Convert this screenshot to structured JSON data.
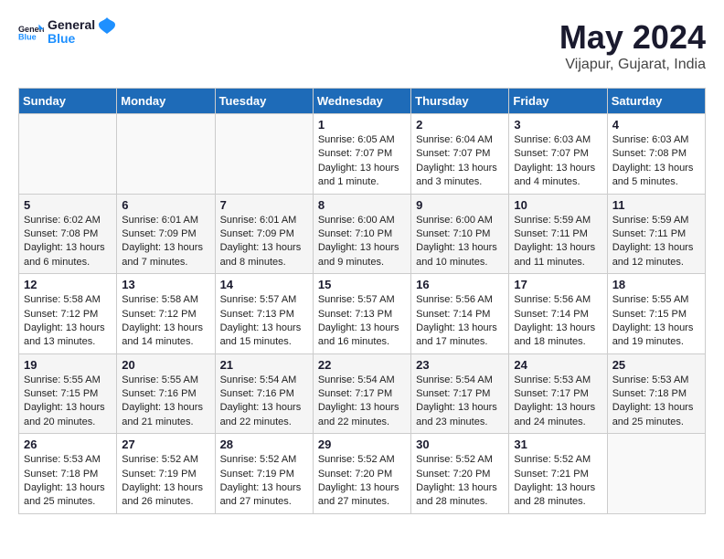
{
  "header": {
    "logo_general": "General",
    "logo_blue": "Blue",
    "month_year": "May 2024",
    "location": "Vijapur, Gujarat, India"
  },
  "days_of_week": [
    "Sunday",
    "Monday",
    "Tuesday",
    "Wednesday",
    "Thursday",
    "Friday",
    "Saturday"
  ],
  "weeks": [
    [
      {
        "day": "",
        "info": ""
      },
      {
        "day": "",
        "info": ""
      },
      {
        "day": "",
        "info": ""
      },
      {
        "day": "1",
        "info": "Sunrise: 6:05 AM\nSunset: 7:07 PM\nDaylight: 13 hours\nand 1 minute."
      },
      {
        "day": "2",
        "info": "Sunrise: 6:04 AM\nSunset: 7:07 PM\nDaylight: 13 hours\nand 3 minutes."
      },
      {
        "day": "3",
        "info": "Sunrise: 6:03 AM\nSunset: 7:07 PM\nDaylight: 13 hours\nand 4 minutes."
      },
      {
        "day": "4",
        "info": "Sunrise: 6:03 AM\nSunset: 7:08 PM\nDaylight: 13 hours\nand 5 minutes."
      }
    ],
    [
      {
        "day": "5",
        "info": "Sunrise: 6:02 AM\nSunset: 7:08 PM\nDaylight: 13 hours\nand 6 minutes."
      },
      {
        "day": "6",
        "info": "Sunrise: 6:01 AM\nSunset: 7:09 PM\nDaylight: 13 hours\nand 7 minutes."
      },
      {
        "day": "7",
        "info": "Sunrise: 6:01 AM\nSunset: 7:09 PM\nDaylight: 13 hours\nand 8 minutes."
      },
      {
        "day": "8",
        "info": "Sunrise: 6:00 AM\nSunset: 7:10 PM\nDaylight: 13 hours\nand 9 minutes."
      },
      {
        "day": "9",
        "info": "Sunrise: 6:00 AM\nSunset: 7:10 PM\nDaylight: 13 hours\nand 10 minutes."
      },
      {
        "day": "10",
        "info": "Sunrise: 5:59 AM\nSunset: 7:11 PM\nDaylight: 13 hours\nand 11 minutes."
      },
      {
        "day": "11",
        "info": "Sunrise: 5:59 AM\nSunset: 7:11 PM\nDaylight: 13 hours\nand 12 minutes."
      }
    ],
    [
      {
        "day": "12",
        "info": "Sunrise: 5:58 AM\nSunset: 7:12 PM\nDaylight: 13 hours\nand 13 minutes."
      },
      {
        "day": "13",
        "info": "Sunrise: 5:58 AM\nSunset: 7:12 PM\nDaylight: 13 hours\nand 14 minutes."
      },
      {
        "day": "14",
        "info": "Sunrise: 5:57 AM\nSunset: 7:13 PM\nDaylight: 13 hours\nand 15 minutes."
      },
      {
        "day": "15",
        "info": "Sunrise: 5:57 AM\nSunset: 7:13 PM\nDaylight: 13 hours\nand 16 minutes."
      },
      {
        "day": "16",
        "info": "Sunrise: 5:56 AM\nSunset: 7:14 PM\nDaylight: 13 hours\nand 17 minutes."
      },
      {
        "day": "17",
        "info": "Sunrise: 5:56 AM\nSunset: 7:14 PM\nDaylight: 13 hours\nand 18 minutes."
      },
      {
        "day": "18",
        "info": "Sunrise: 5:55 AM\nSunset: 7:15 PM\nDaylight: 13 hours\nand 19 minutes."
      }
    ],
    [
      {
        "day": "19",
        "info": "Sunrise: 5:55 AM\nSunset: 7:15 PM\nDaylight: 13 hours\nand 20 minutes."
      },
      {
        "day": "20",
        "info": "Sunrise: 5:55 AM\nSunset: 7:16 PM\nDaylight: 13 hours\nand 21 minutes."
      },
      {
        "day": "21",
        "info": "Sunrise: 5:54 AM\nSunset: 7:16 PM\nDaylight: 13 hours\nand 22 minutes."
      },
      {
        "day": "22",
        "info": "Sunrise: 5:54 AM\nSunset: 7:17 PM\nDaylight: 13 hours\nand 22 minutes."
      },
      {
        "day": "23",
        "info": "Sunrise: 5:54 AM\nSunset: 7:17 PM\nDaylight: 13 hours\nand 23 minutes."
      },
      {
        "day": "24",
        "info": "Sunrise: 5:53 AM\nSunset: 7:17 PM\nDaylight: 13 hours\nand 24 minutes."
      },
      {
        "day": "25",
        "info": "Sunrise: 5:53 AM\nSunset: 7:18 PM\nDaylight: 13 hours\nand 25 minutes."
      }
    ],
    [
      {
        "day": "26",
        "info": "Sunrise: 5:53 AM\nSunset: 7:18 PM\nDaylight: 13 hours\nand 25 minutes."
      },
      {
        "day": "27",
        "info": "Sunrise: 5:52 AM\nSunset: 7:19 PM\nDaylight: 13 hours\nand 26 minutes."
      },
      {
        "day": "28",
        "info": "Sunrise: 5:52 AM\nSunset: 7:19 PM\nDaylight: 13 hours\nand 27 minutes."
      },
      {
        "day": "29",
        "info": "Sunrise: 5:52 AM\nSunset: 7:20 PM\nDaylight: 13 hours\nand 27 minutes."
      },
      {
        "day": "30",
        "info": "Sunrise: 5:52 AM\nSunset: 7:20 PM\nDaylight: 13 hours\nand 28 minutes."
      },
      {
        "day": "31",
        "info": "Sunrise: 5:52 AM\nSunset: 7:21 PM\nDaylight: 13 hours\nand 28 minutes."
      },
      {
        "day": "",
        "info": ""
      }
    ]
  ]
}
